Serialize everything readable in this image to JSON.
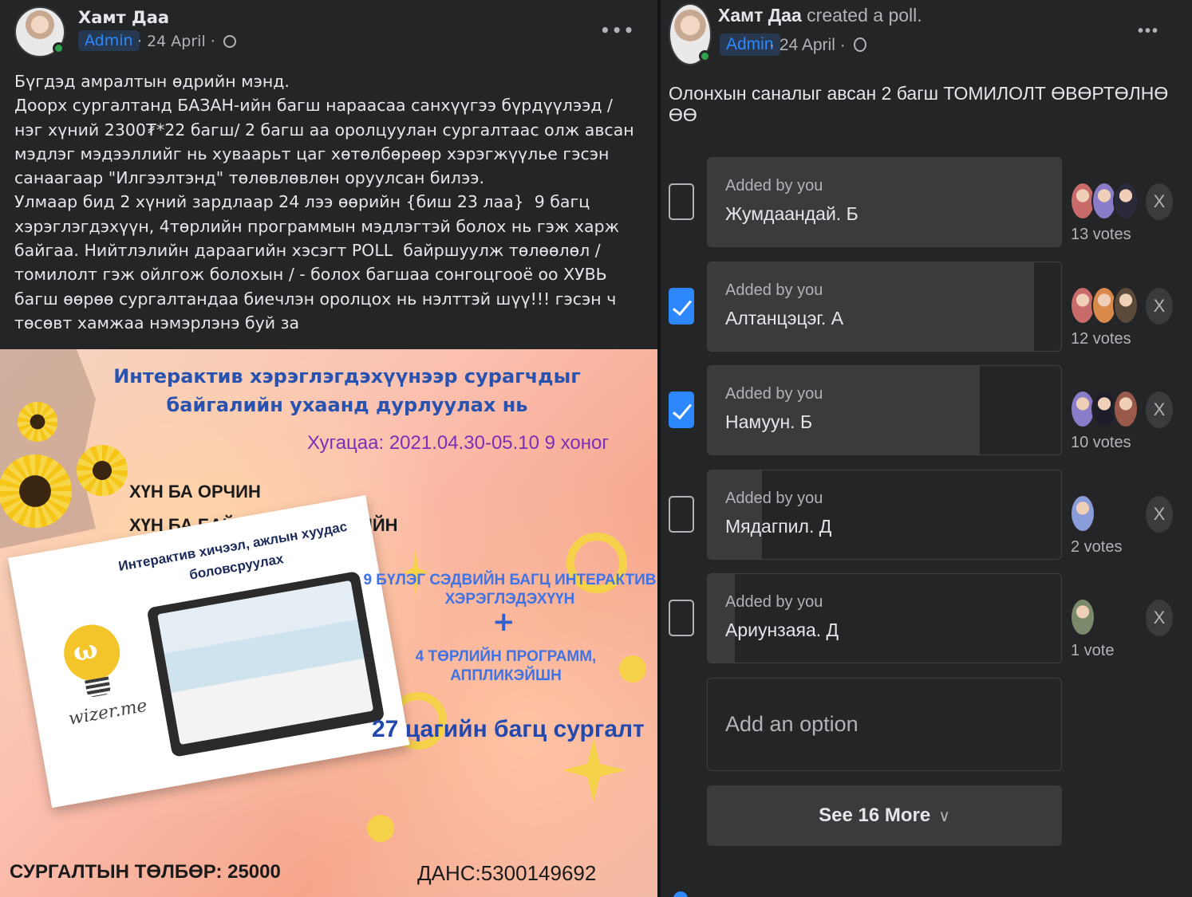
{
  "left_post": {
    "author": "Хамт Даа",
    "badge": "Admin",
    "date": "· 24 April ·",
    "audience_icon": "globe-icon",
    "more_icon": "•••",
    "text": "Бүгдэд амралтын өдрийн мэнд.\nДоорх сургалтанд БАЗАН-ийн багш нараасаа санхүүгээ бүрдүүлээд / нэг хүний 2300₮*22 багш/ 2 багш аа оролцуулан сургалтаас олж авсан мэдлэг мэдээллийг нь хуваарьт цаг хөтөлбөрөөр хэрэгжүүлье гэсэн санаагаар \"Илгээлтэнд\" төлөвлөвлөн оруулсан билээ.\nУлмаар бид 2 хүний зардлаар 24 лээ өөрийн {биш 23 лаа}  9 багц хэрэглэгдэхүүн, 4төрлийн программын мэдлэгтэй болох нь гэж харж байгаа. Нийтлэлийн дараагийн хэсэгт POLL  байршуулж төлөөлөл / томилолт гэж ойлгож болохын / - болох багшаа сонгоцгооё оо ХУВЬ багш өөрөө сургалтандаа биечлэн оролцох нь нэлттэй шүү!!! гэсэн ч төсөвт хамжаа нэмэрлэнэ буй за",
    "poster": {
      "title": "Интерактив хэрэглэгдэхүүнээр сурагчдыг байгалийн ухаанд дурлуулах нь",
      "date": "Хугацаа: 2021.04.30-05.10 9 хоног",
      "subject1": "ХҮН БА ОРЧИН",
      "subject2": "ХҮН БА БАЙГАЛЬ ХИЧЭЭЛИЙН",
      "card_title": "Интерактив хичээл, ажлын хуудас боловсруулах",
      "wizer_logo": "wizer.me",
      "line1": "9 БҮЛЭГ СЭДВИЙН БАГЦ ИНТЕРАКТИВ ХЭРЭГЛЭДЭХҮҮН",
      "plus": "+",
      "line2": "4 ТӨРЛИЙН ПРОГРАММ, АППЛИКЭЙШН",
      "line3": "27 цагийн багц сургалт",
      "fee": "СУРГАЛТЫН ТӨЛБӨР: 25000",
      "account": "ДАНС:5300149692"
    }
  },
  "poll_post": {
    "author": "Хамт Даа",
    "action": " created a poll.",
    "badge": "Admin",
    "date": "· 24 April ·",
    "audience_icon": "globe-icon",
    "more_icon": "•••",
    "question": "Олонхын саналыг авсан 2 багш ТОМИЛОЛТ ӨВӨРТӨЛНӨ ӨӨ",
    "options": [
      {
        "added_by": "Added by you",
        "label": "Жумдаандай. Б",
        "votes_label": "13 votes",
        "votes": 13,
        "checked": false
      },
      {
        "added_by": "Added by you",
        "label": "Алтанцэцэг. А",
        "votes_label": "12 votes",
        "votes": 12,
        "checked": true
      },
      {
        "added_by": "Added by you",
        "label": "Намуун. Б",
        "votes_label": "10 votes",
        "votes": 10,
        "checked": true
      },
      {
        "added_by": "Added by you",
        "label": "Мядагпил. Д",
        "votes_label": "2 votes",
        "votes": 2,
        "checked": false
      },
      {
        "added_by": "Added by you",
        "label": "Ариунзаяа. Д",
        "votes_label": "1 vote",
        "votes": 1,
        "checked": false
      }
    ],
    "remove_label": "X",
    "add_option_placeholder": "Add an option",
    "see_more_label": "See 16 More",
    "see_more_icon": "∨"
  }
}
